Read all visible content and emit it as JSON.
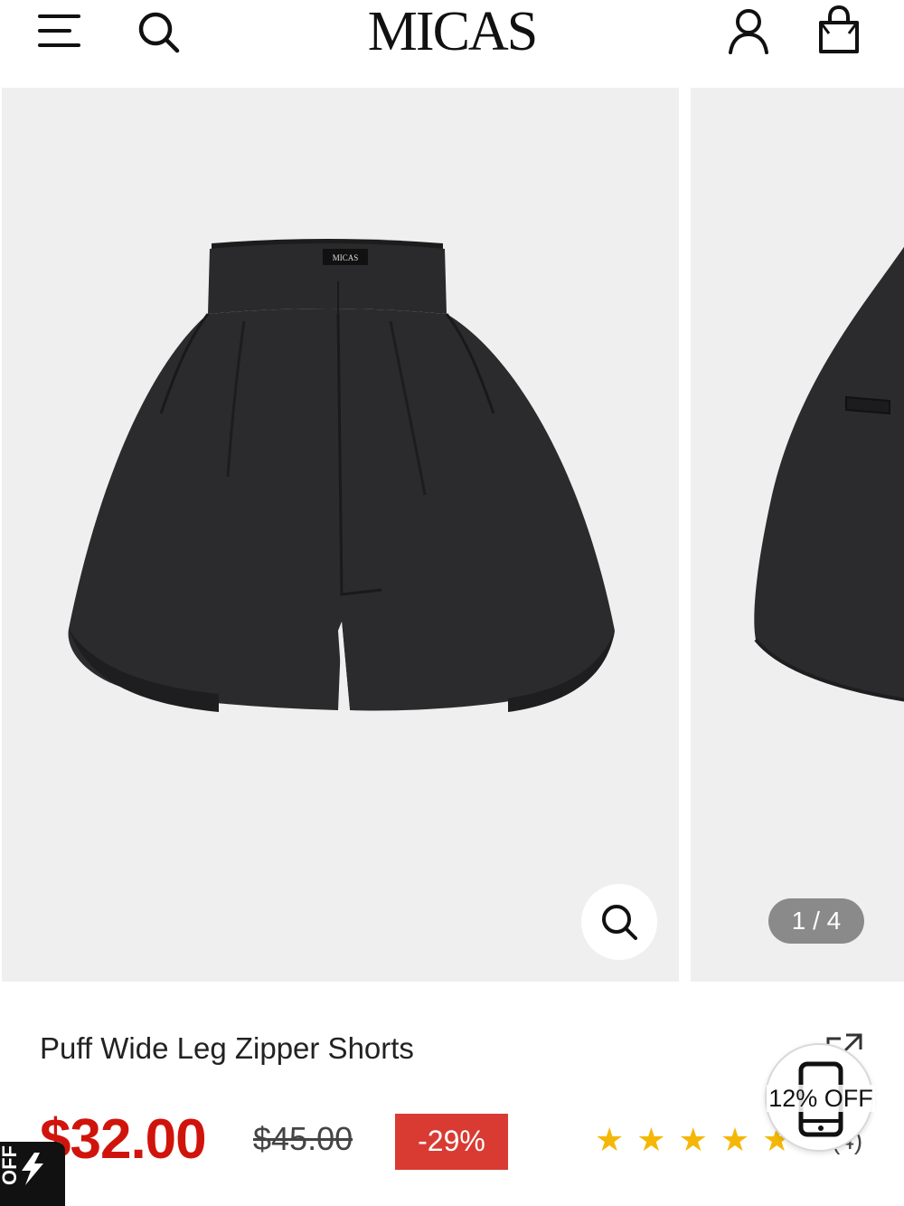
{
  "header": {
    "logo": "MICAS",
    "icons": [
      "menu-icon",
      "search-icon",
      "account-icon",
      "shopping-bag-icon"
    ]
  },
  "gallery": {
    "pager": "1 / 4",
    "waistband_label": "MICAS",
    "zoom_icon": "magnifier-icon"
  },
  "product": {
    "title": "Puff Wide Leg Zipper Shorts",
    "price": "$32.00",
    "original_price": "$45.00",
    "discount": "-29%",
    "rating_stars": 5,
    "review_count": "(4)",
    "share_icon": "share-icon"
  },
  "promo_badge": {
    "text": "12% OFF",
    "icon": "phone-icon"
  },
  "flash_tab": {
    "text": "OFF",
    "icon": "lightning-icon"
  },
  "colors": {
    "price": "#d0140c",
    "discount_bg": "#d93b33",
    "star": "#f5b705",
    "image_bg": "#efefef",
    "pager_bg": "#8a8a8a"
  }
}
